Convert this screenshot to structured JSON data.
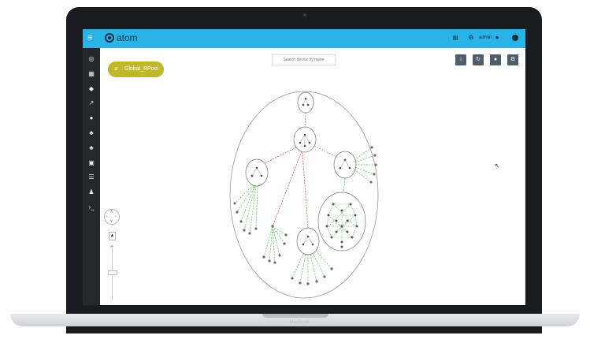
{
  "app": {
    "name": "atom"
  },
  "topbar": {
    "menu_icon": "hamburger-icon",
    "user_label": "admin",
    "icons": [
      "clipboard-icon",
      "gear-icon",
      "person-icon",
      "location-pin-icon"
    ]
  },
  "sidebar": {
    "items": [
      "globe-icon",
      "map-icon",
      "shield-icon",
      "chart-icon",
      "pin-icon",
      "hierarchy-icon",
      "network-icon",
      "document-icon",
      "list-icon",
      "user-icon",
      "terminal-icon"
    ]
  },
  "filter": {
    "label": "Global_RPool"
  },
  "search": {
    "placeholder": "Search device by name"
  },
  "toolbar": {
    "buttons": [
      "sort-icon",
      "refresh-icon",
      "pin-icon",
      "settings-icon"
    ]
  },
  "device": {
    "brand": "MacBook"
  },
  "colors": {
    "topbar": "#2ab3e8",
    "sidebar": "#25272b",
    "pill": "#bfb82a",
    "link_up": "#5cbf5c",
    "link_down": "#d45a4c"
  }
}
